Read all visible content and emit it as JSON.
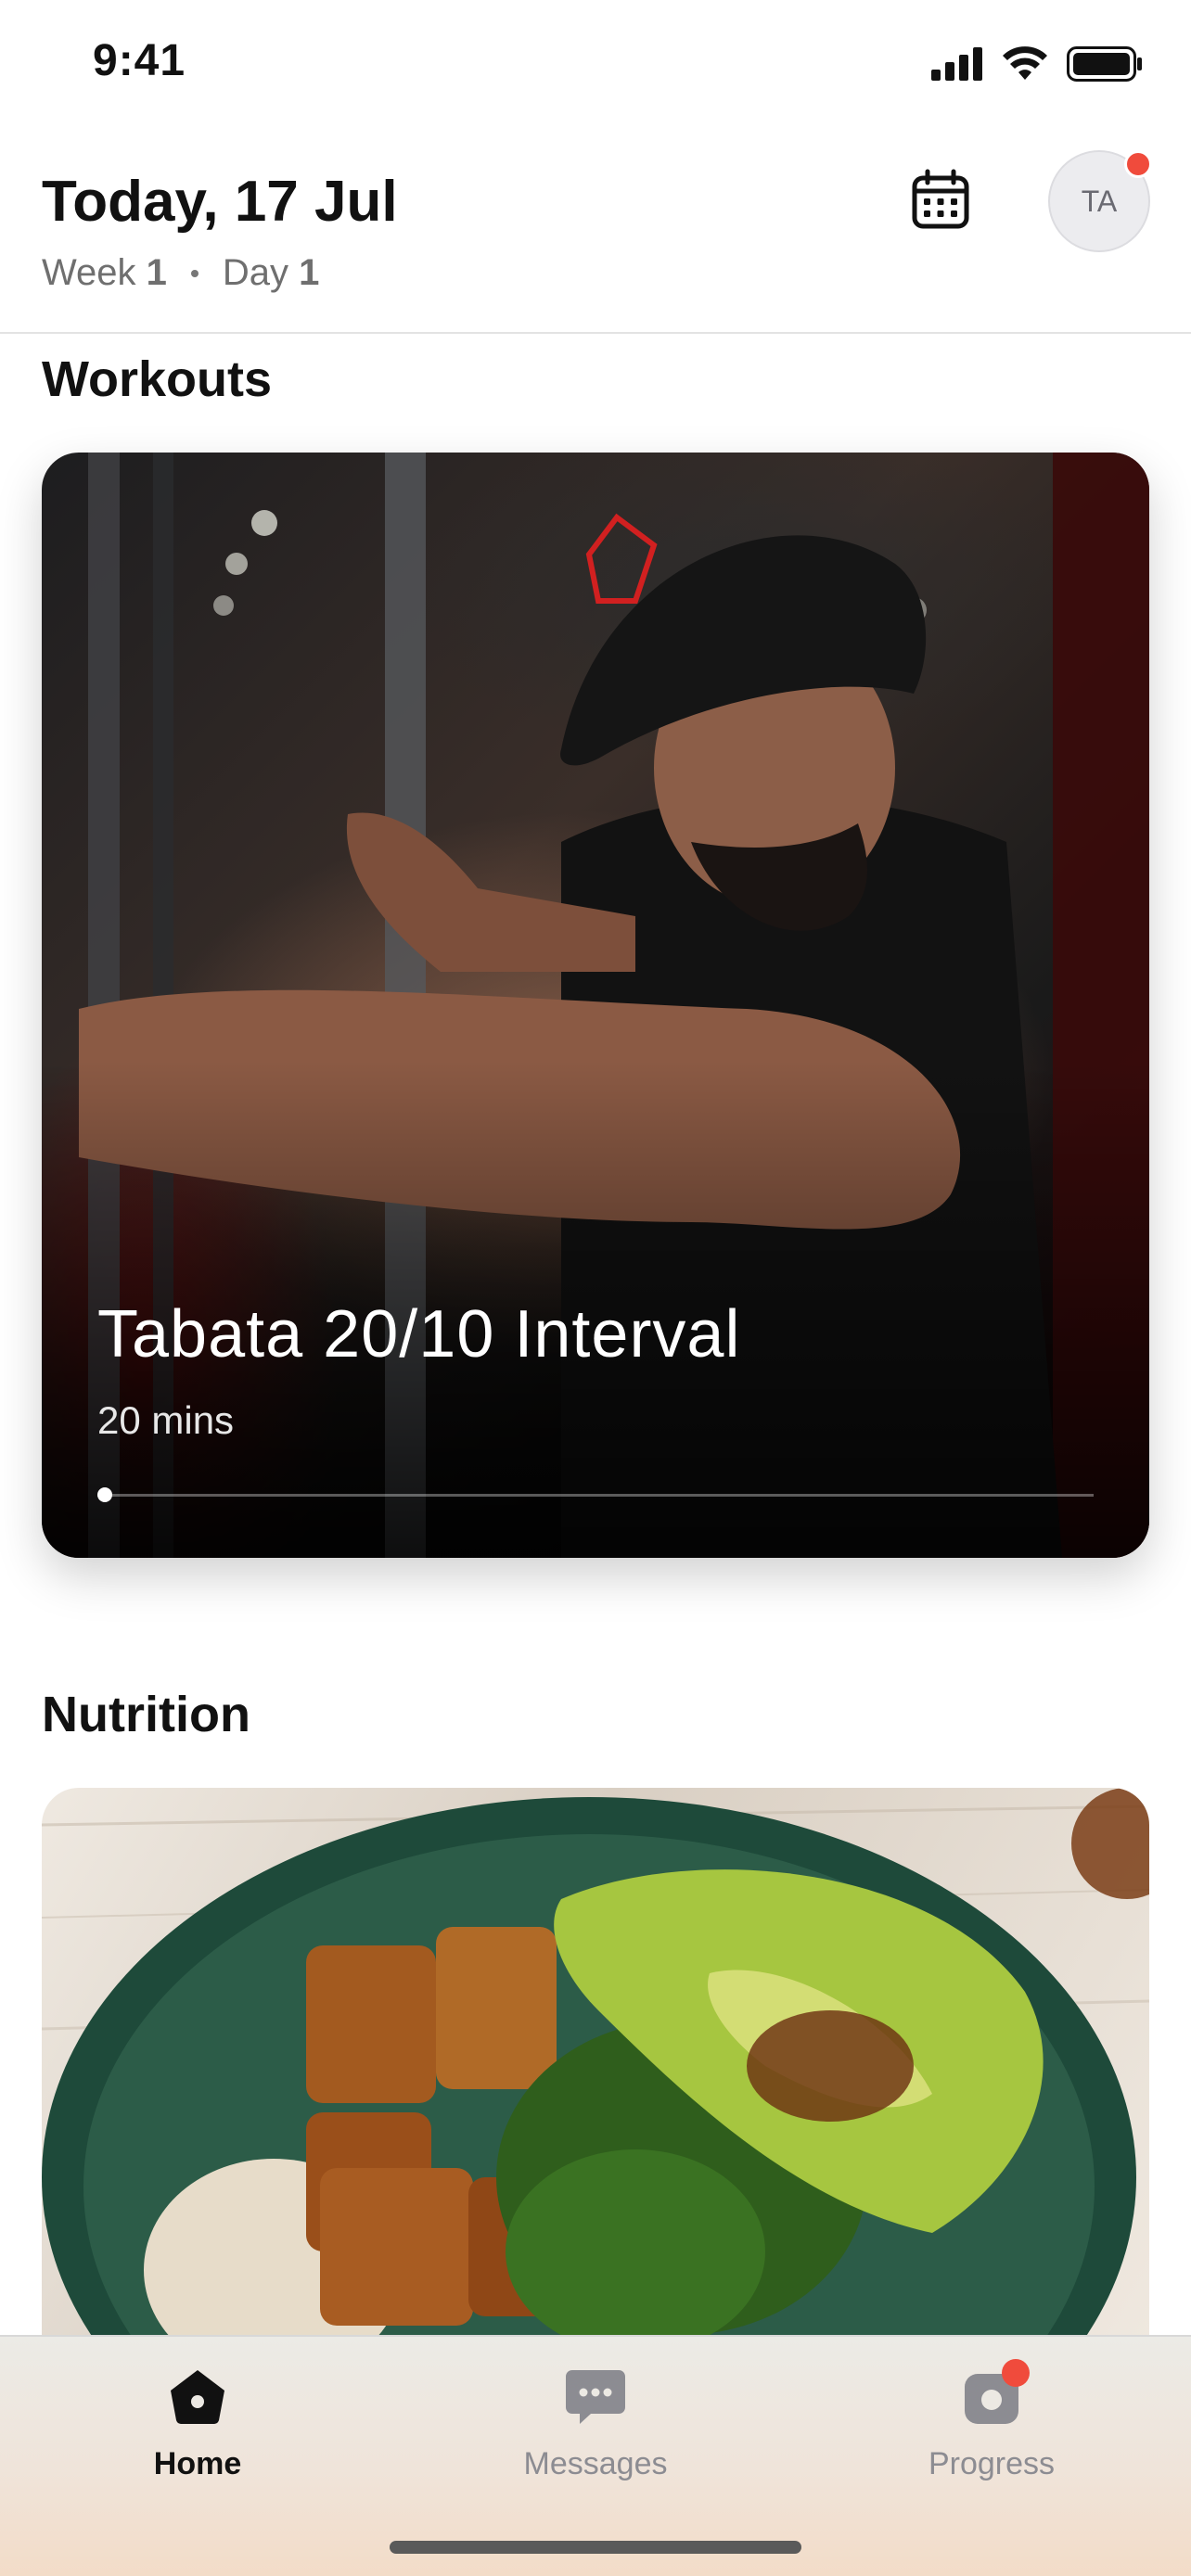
{
  "status_bar": {
    "time": "9:41",
    "icons": [
      "cellular-signal-icon",
      "wifi-icon",
      "battery-icon"
    ]
  },
  "header": {
    "date_title": "Today, 17 Jul",
    "week_label": "Week",
    "week_number": "1",
    "day_label": "Day",
    "day_number": "1",
    "calendar_icon": "calendar-icon",
    "avatar_initials": "TA",
    "avatar_has_notification": true
  },
  "sections": {
    "workouts_title": "Workouts",
    "nutrition_title": "Nutrition"
  },
  "workout_card": {
    "title": "Tabata 20/10 Interval",
    "duration": "20 mins",
    "progress": 0.0
  },
  "tab_bar": {
    "tabs": [
      {
        "label": "Home",
        "icon": "home-icon",
        "active": true
      },
      {
        "label": "Messages",
        "icon": "chat-bubble-icon",
        "active": false
      },
      {
        "label": "Progress",
        "icon": "camera-icon",
        "active": false,
        "badge": true
      }
    ]
  },
  "colors": {
    "badge": "#f04b3c",
    "text_primary": "#111111",
    "text_secondary": "#6f6f6f",
    "tab_inactive": "#8c8c92"
  }
}
